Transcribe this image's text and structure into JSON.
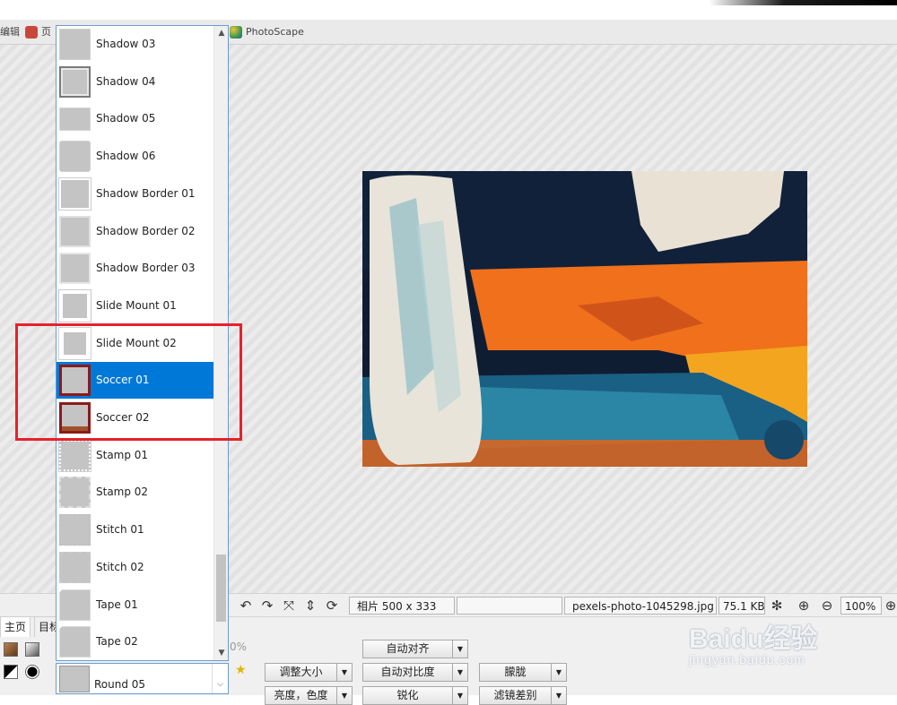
{
  "tabbar": {
    "tabs": [
      {
        "label": "编辑"
      },
      {
        "label": "页"
      },
      {
        "label": "PhotoScape"
      }
    ]
  },
  "photo": {
    "subject": "abstract acrylic painting"
  },
  "frame_list": {
    "items": [
      {
        "label": "Shadow 03",
        "selected": false
      },
      {
        "label": "Shadow 04",
        "selected": false
      },
      {
        "label": "Shadow 05",
        "selected": false
      },
      {
        "label": "Shadow 06",
        "selected": false
      },
      {
        "label": "Shadow Border 01",
        "selected": false
      },
      {
        "label": "Shadow Border 02",
        "selected": false
      },
      {
        "label": "Shadow Border 03",
        "selected": false
      },
      {
        "label": "Slide Mount 01",
        "selected": false
      },
      {
        "label": "Slide Mount 02",
        "selected": false
      },
      {
        "label": "Soccer 01",
        "selected": true
      },
      {
        "label": "Soccer 02",
        "selected": false
      },
      {
        "label": "Stamp 01",
        "selected": false
      },
      {
        "label": "Stamp 02",
        "selected": false
      },
      {
        "label": "Stitch 01",
        "selected": false
      },
      {
        "label": "Stitch 02",
        "selected": false
      },
      {
        "label": "Tape 01",
        "selected": false
      },
      {
        "label": "Tape 02",
        "selected": false
      }
    ],
    "scroll_up_icon": "▲",
    "scroll_down_icon": "▼"
  },
  "frame_combo": {
    "value": "Round 05",
    "arrow": "⌵"
  },
  "status": {
    "photo_size": "相片 500 x 333",
    "filename": "pexels-photo-1045298.jpg",
    "filesize": "75.1 KB",
    "zoom": "100%"
  },
  "panel_tabs": {
    "home": "主页",
    "target": "目标"
  },
  "opacity_partial": "0%",
  "buttons": {
    "auto_align": "自动对齐",
    "resize": "调整大小",
    "auto_contrast": "自动对比度",
    "hazy": "朦胧",
    "brightness": "亮度，色度",
    "sharpen": "锐化",
    "filter": "滤镜差别"
  },
  "dropdown_arrow": "▼",
  "watermark": {
    "main": "Baidu经验",
    "sub": "jingyan.baidu.com"
  },
  "colors": {
    "selection": "#0078d7",
    "highlight_box": "#e8202a",
    "dropdown_border": "#6b9bd1"
  }
}
